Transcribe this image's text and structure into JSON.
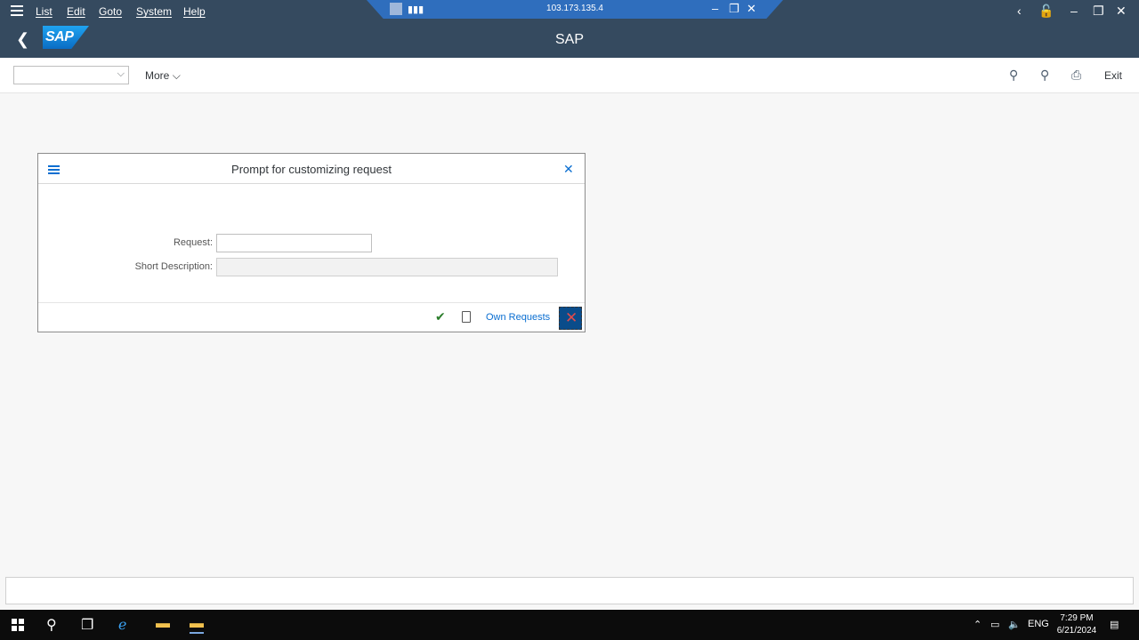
{
  "menubar": {
    "items": [
      "List",
      "Edit",
      "Goto",
      "System",
      "Help"
    ],
    "remote_ip": "103.173.135.4"
  },
  "shell": {
    "logo_text": "SAP",
    "title": "SAP"
  },
  "toolbar": {
    "command_field_value": "",
    "more_label": "More",
    "exit_label": "Exit"
  },
  "dialog": {
    "title": "Prompt for customizing request",
    "request_label": "Request:",
    "request_value": "",
    "short_description_label": "Short Description:",
    "short_description_value": "",
    "own_requests_label": "Own Requests"
  },
  "statusbar": {
    "message": ""
  },
  "taskbar": {
    "language": "ENG",
    "time": "7:29 PM",
    "date": "6/21/2024"
  },
  "colors": {
    "shell_bg": "#354a5f",
    "accent": "#0a6ed1",
    "ok_green": "#2b7d2b",
    "cancel_red": "#e04b4b"
  }
}
